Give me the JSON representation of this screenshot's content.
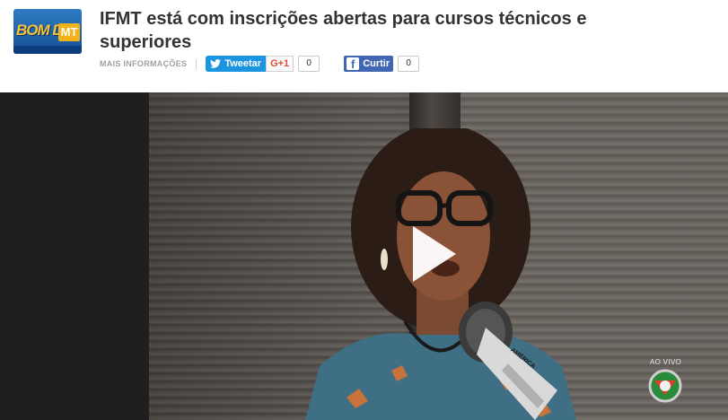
{
  "header": {
    "logo": {
      "word": "BOM DIA",
      "badge": "MT"
    },
    "title": "IFMT está com inscrições abertas para cursos técnicos e superiores"
  },
  "share": {
    "more_info_label": "MAIS INFORMAÇÕES",
    "tweet_label": "Tweetar",
    "gplus_label": "G+1",
    "gplus_count": "0",
    "facebook_label": "Curtir",
    "facebook_count": "0"
  },
  "video": {
    "live_label": "AO VIVO",
    "mic_brand": "AMÉRICA",
    "play_icon": "play-icon"
  },
  "colors": {
    "twitter": "#1b95e0",
    "facebook": "#4267b2",
    "gplus": "#dd4b39",
    "title": "#333333"
  }
}
